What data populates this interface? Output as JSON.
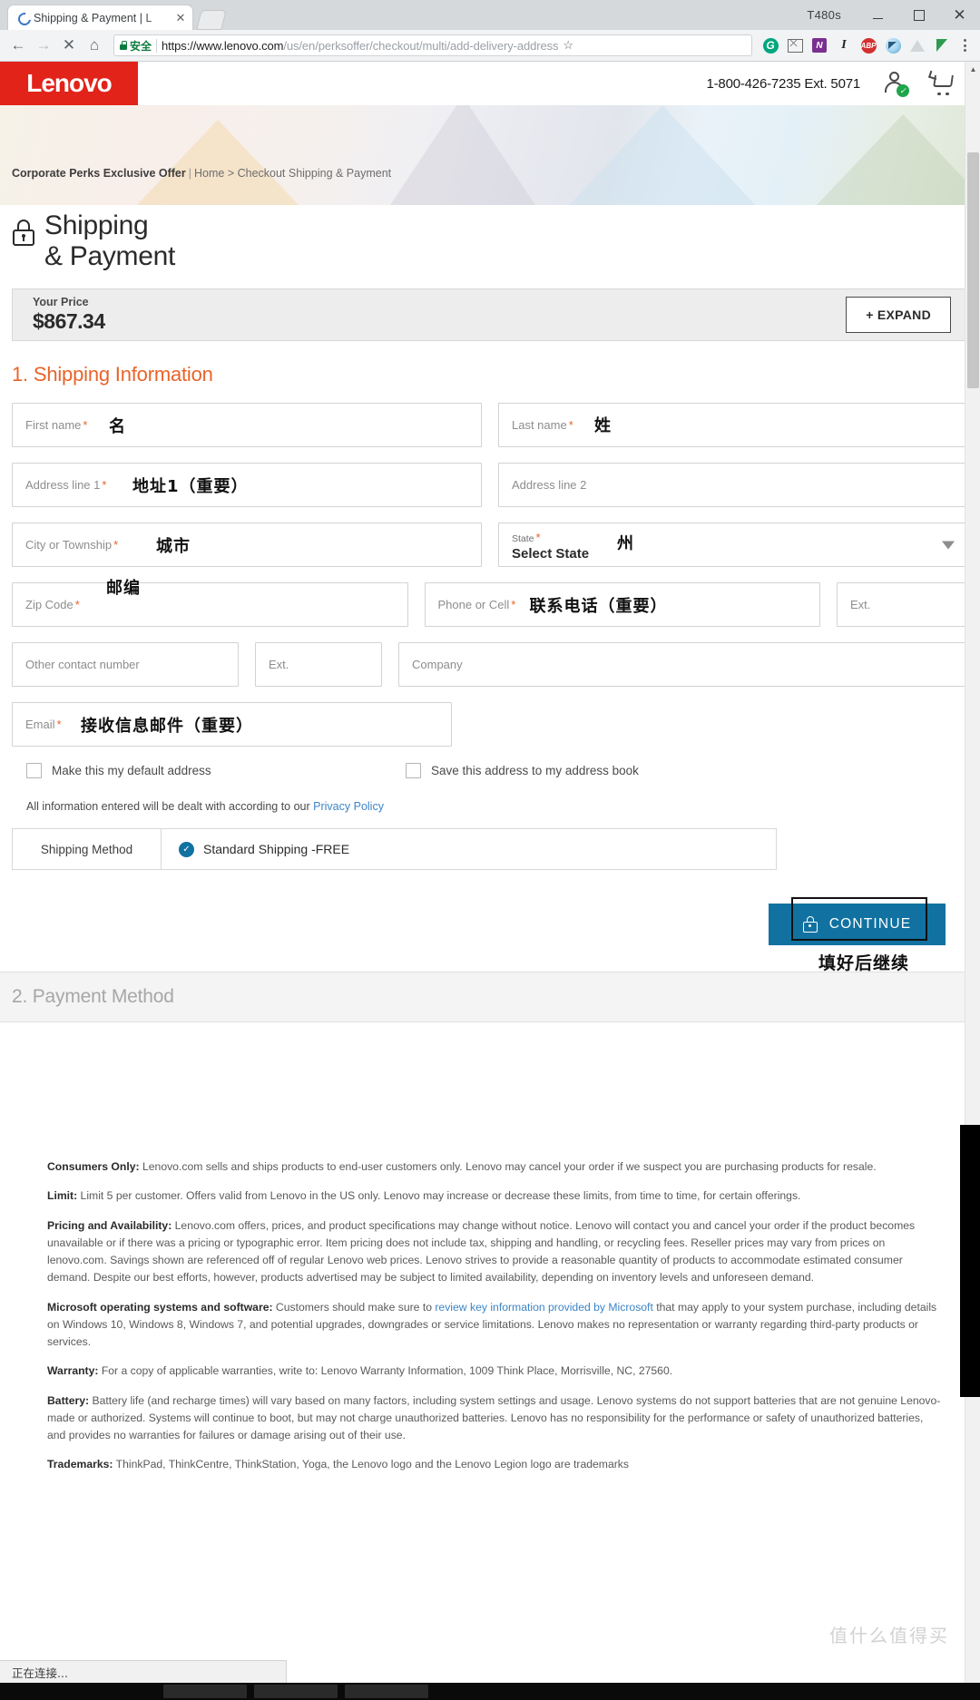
{
  "browser": {
    "tab": {
      "title": "Shipping & Payment | L",
      "close_label": "✕",
      "favicon": "loading-spinner-icon"
    },
    "new_tab_label": "",
    "window": {
      "machine_name": "T480s",
      "minimize_label": "",
      "maximize_label": "",
      "close_label": "✕"
    },
    "nav": {
      "back": "←",
      "forward": "→",
      "stop": "✕",
      "home": "⌂"
    },
    "omnibox": {
      "security_label": "安全",
      "url_host": "https://www.lenovo.com",
      "url_path": "/us/en/perksoffer/checkout/multi/add-delivery-address",
      "bookmark_star": "☆"
    },
    "extensions": [
      {
        "name": "grammarly-extension-icon",
        "glyph": "G"
      },
      {
        "name": "gmail-checker-extension-icon",
        "glyph": ""
      },
      {
        "name": "onenote-extension-icon",
        "glyph": "N"
      },
      {
        "name": "evernote-extension-icon",
        "glyph": "I"
      },
      {
        "name": "adblock-plus-extension-icon",
        "glyph": "ABP"
      },
      {
        "name": "shark-extension-icon",
        "glyph": ""
      },
      {
        "name": "drive-extension-icon",
        "glyph": ""
      },
      {
        "name": "green-extension-icon",
        "glyph": ""
      }
    ],
    "menu_label": "chrome-menu-icon"
  },
  "site_header": {
    "logo_text": "Lenovo",
    "logo_tm": "™",
    "phone": "1-800-426-7235 Ext. 5071",
    "account_icon": "account-verified-icon",
    "cart_icon": "shopping-cart-icon"
  },
  "breadcrumb": {
    "offer": "Corporate Perks Exclusive Offer",
    "divider": "|",
    "trail": "Home > Checkout Shipping & Payment"
  },
  "page": {
    "title_line1": "Shipping",
    "title_line2": "& Payment",
    "lock_icon": "secure-lock-icon"
  },
  "price_bar": {
    "label": "Your Price",
    "value": "$867.34",
    "expand_label": "+ EXPAND"
  },
  "shipping_section": {
    "title": "1. Shipping Information",
    "fields": {
      "first_name": {
        "label": "First name",
        "required": "*",
        "value": ""
      },
      "last_name": {
        "label": "Last name",
        "required": "*",
        "value": ""
      },
      "address1": {
        "label": "Address line 1",
        "required": "*",
        "value": ""
      },
      "address2": {
        "label": "Address line 2",
        "required": "",
        "value": ""
      },
      "city": {
        "label": "City or Township",
        "required": "*",
        "value": ""
      },
      "state": {
        "label": "State",
        "required": "*",
        "selected": "Select State"
      },
      "zip": {
        "label": "Zip Code",
        "required": "*",
        "value": ""
      },
      "phone": {
        "label": "Phone or Cell",
        "required": "*",
        "value": ""
      },
      "phone_ext": {
        "label": "Ext.",
        "required": "",
        "value": ""
      },
      "other_contact": {
        "label": "Other contact number",
        "required": "",
        "value": ""
      },
      "other_ext": {
        "label": "Ext.",
        "required": "",
        "value": ""
      },
      "company": {
        "label": "Company",
        "required": "",
        "value": ""
      },
      "email": {
        "label": "Email",
        "required": "*",
        "value": ""
      }
    },
    "checkboxes": {
      "default_address": "Make this my default address",
      "save_address": "Save this address to my address book"
    },
    "privacy_note": "All information entered will be dealt with according to our",
    "privacy_link": "Privacy Policy",
    "shipping_method": {
      "label": "Shipping Method",
      "option": "Standard Shipping -FREE",
      "selected_icon": "radio-selected-icon"
    },
    "continue_label": "CONTINUE",
    "continue_lock_icon": "lock-icon"
  },
  "annotations": {
    "first_name": "名",
    "last_name": "姓",
    "address1": "地址1（重要）",
    "city": "城市",
    "state": "州",
    "zip": "邮编",
    "phone": "联系电话（重要）",
    "email": "接收信息邮件（重要）",
    "continue": "填好后继续"
  },
  "payment_section": {
    "title": "2. Payment Method"
  },
  "legal": [
    {
      "heading": "Consumers Only:",
      "text": " Lenovo.com sells and ships products to end-user customers only. Lenovo may cancel your order if we suspect you are purchasing products for resale."
    },
    {
      "heading": "Limit:",
      "text": " Limit 5 per customer. Offers valid from Lenovo in the US only. Lenovo may increase or decrease these limits, from time to time, for certain offerings."
    },
    {
      "heading": "Pricing and Availability:",
      "text": " Lenovo.com offers, prices, and product specifications may change without notice. Lenovo will contact you and cancel your order if the product becomes unavailable or if there was a pricing or typographic error. Item pricing does not include tax, shipping and handling, or recycling fees. Reseller prices may vary from prices on lenovo.com. Savings shown are referenced off of regular Lenovo web prices. Lenovo strives to provide a reasonable quantity of products to accommodate estimated consumer demand. Despite our best efforts, however, products advertised may be subject to limited availability, depending on inventory levels and unforeseen demand."
    },
    {
      "heading": "Microsoft operating systems and software:",
      "text": " Customers should make sure to ",
      "link": "review key information provided by Microsoft",
      "text2": " that may apply to your system purchase, including details on Windows 10, Windows 8, Windows 7, and potential upgrades, downgrades or service limitations. Lenovo makes no representation or warranty regarding third-party products or services."
    },
    {
      "heading": "Warranty:",
      "text": " For a copy of applicable warranties, write to: Lenovo Warranty Information, 1009 Think Place, Morrisville, NC, 27560."
    },
    {
      "heading": "Battery:",
      "text": " Battery life (and recharge times) will vary based on many factors, including system settings and usage. Lenovo systems do not support batteries that are not genuine Lenovo-made or authorized. Systems will continue to boot, but may not charge unauthorized batteries. Lenovo has no responsibility for the performance or safety of unauthorized batteries, and provides no warranties for failures or damage arising out of their use."
    },
    {
      "heading": "Trademarks:",
      "text": " ThinkPad, ThinkCentre, ThinkStation, Yoga, the Lenovo logo and the Lenovo Legion logo are trademarks"
    }
  ],
  "status_bar": {
    "text": "正在连接..."
  },
  "watermark": "值什么值得买",
  "colors": {
    "lenovo_red": "#e2231a",
    "section_orange": "#e8642a",
    "continue_blue": "#1172a1",
    "link_blue": "#3d85c6"
  }
}
